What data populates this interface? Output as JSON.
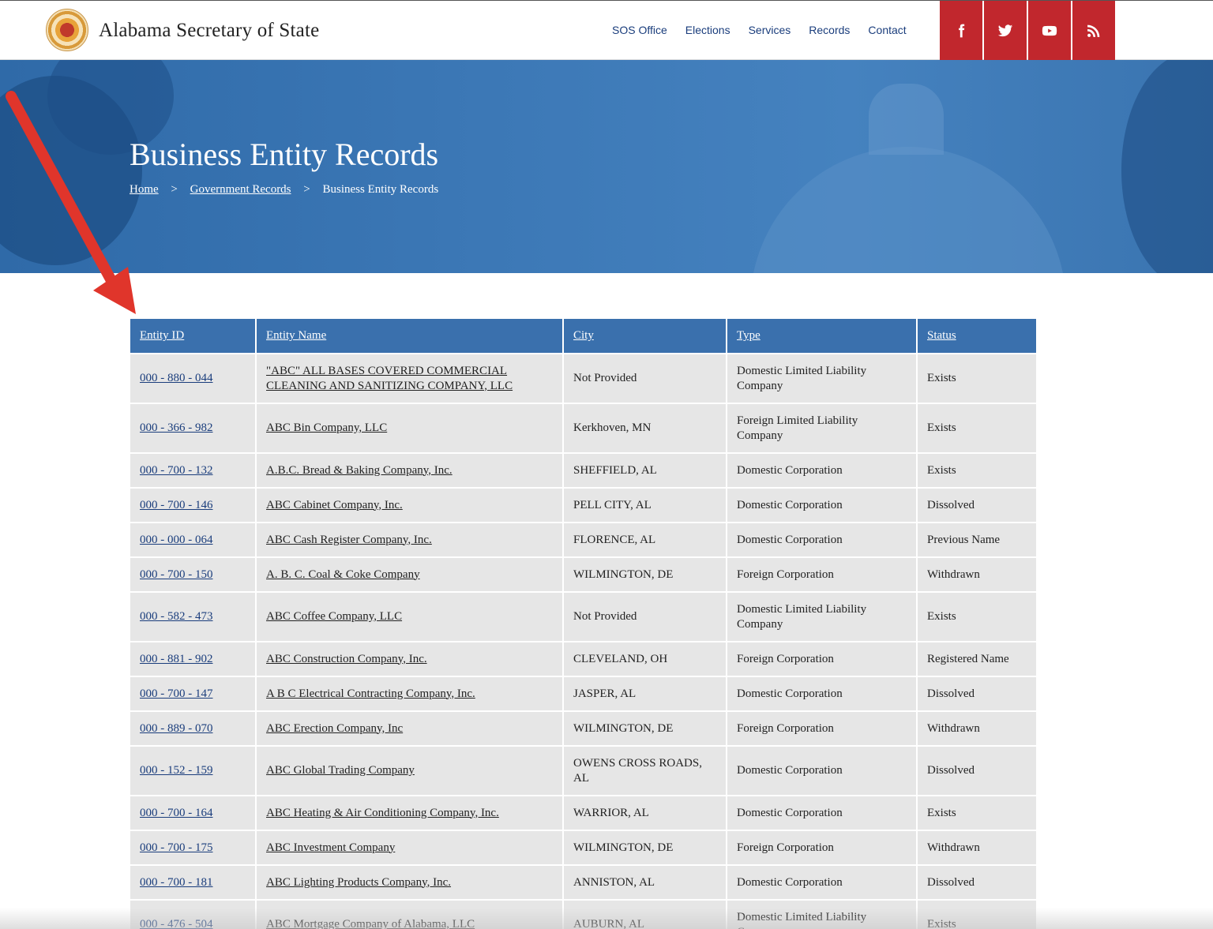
{
  "header": {
    "site_title": "Alabama Secretary of State",
    "nav": [
      {
        "label": "SOS Office"
      },
      {
        "label": "Elections"
      },
      {
        "label": "Services"
      },
      {
        "label": "Records"
      },
      {
        "label": "Contact"
      }
    ],
    "social": [
      {
        "icon": "facebook-icon"
      },
      {
        "icon": "twitter-icon"
      },
      {
        "icon": "youtube-icon"
      },
      {
        "icon": "rss-icon"
      }
    ],
    "social_color": "#c1272d"
  },
  "hero": {
    "title": "Business Entity Records",
    "breadcrumb": {
      "home": "Home",
      "sep1": ">",
      "records": "Government Records",
      "sep2": ">",
      "current": "Business Entity Records"
    }
  },
  "table": {
    "headers": {
      "id": "Entity ID",
      "name": "Entity Name",
      "city": "City",
      "type": "Type",
      "status": "Status"
    },
    "rows": [
      {
        "id": "000 - 880 - 044",
        "name": "\"ABC\" ALL BASES COVERED COMMERCIAL CLEANING AND SANITIZING COMPANY, LLC",
        "city": "Not Provided",
        "type": "Domestic Limited Liability Company",
        "status": "Exists"
      },
      {
        "id": "000 - 366 - 982",
        "name": "ABC Bin Company, LLC",
        "city": "Kerkhoven, MN",
        "type": "Foreign Limited Liability Company",
        "status": "Exists"
      },
      {
        "id": "000 - 700 - 132",
        "name": "A.B.C. Bread & Baking Company, Inc.",
        "city": "SHEFFIELD, AL",
        "type": "Domestic Corporation",
        "status": "Exists"
      },
      {
        "id": "000 - 700 - 146",
        "name": "ABC Cabinet Company, Inc.",
        "city": "PELL CITY, AL",
        "type": "Domestic Corporation",
        "status": "Dissolved"
      },
      {
        "id": "000 - 000 - 064",
        "name": "ABC Cash Register Company, Inc.",
        "city": "FLORENCE, AL",
        "type": "Domestic Corporation",
        "status": "Previous Name"
      },
      {
        "id": "000 - 700 - 150",
        "name": "A. B. C. Coal & Coke Company",
        "city": "WILMINGTON, DE",
        "type": "Foreign Corporation",
        "status": "Withdrawn"
      },
      {
        "id": "000 - 582 - 473",
        "name": "ABC Coffee Company, LLC",
        "city": "Not Provided",
        "type": "Domestic Limited Liability Company",
        "status": "Exists"
      },
      {
        "id": "000 - 881 - 902",
        "name": "ABC Construction Company, Inc.",
        "city": "CLEVELAND, OH",
        "type": "Foreign Corporation",
        "status": "Registered Name"
      },
      {
        "id": "000 - 700 - 147",
        "name": "A B C Electrical Contracting Company, Inc.",
        "city": "JASPER, AL",
        "type": "Domestic Corporation",
        "status": "Dissolved"
      },
      {
        "id": "000 - 889 - 070",
        "name": "ABC Erection Company, Inc",
        "city": "WILMINGTON, DE",
        "type": "Foreign Corporation",
        "status": "Withdrawn"
      },
      {
        "id": "000 - 152 - 159",
        "name": "ABC Global Trading Company",
        "city": "OWENS CROSS ROADS, AL",
        "type": "Domestic Corporation",
        "status": "Dissolved"
      },
      {
        "id": "000 - 700 - 164",
        "name": "ABC Heating & Air Conditioning Company, Inc.",
        "city": "WARRIOR, AL",
        "type": "Domestic Corporation",
        "status": "Exists"
      },
      {
        "id": "000 - 700 - 175",
        "name": "ABC Investment Company",
        "city": "WILMINGTON, DE",
        "type": "Foreign Corporation",
        "status": "Withdrawn"
      },
      {
        "id": "000 - 700 - 181",
        "name": "ABC Lighting Products Company, Inc.",
        "city": "ANNISTON, AL",
        "type": "Domestic Corporation",
        "status": "Dissolved"
      },
      {
        "id": "000 - 476 - 504",
        "name": "ABC Mortgage Company of Alabama, LLC",
        "city": "AUBURN, AL",
        "type": "Domestic Limited Liability Company",
        "status": "Exists"
      }
    ]
  },
  "annotation": {
    "arrow_color": "#e0352b"
  }
}
